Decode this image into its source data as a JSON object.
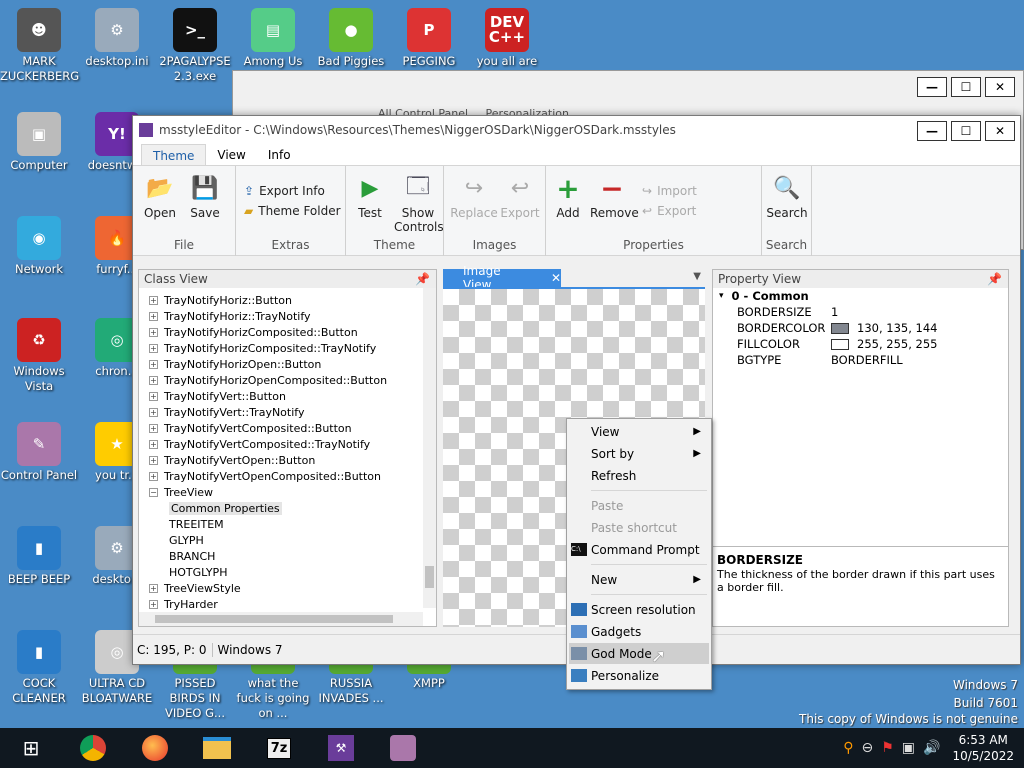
{
  "desktop": {
    "icons": [
      {
        "label": "MARK ZUCKERBERG",
        "glyph": "☻",
        "color": "#555"
      },
      {
        "label": "desktop.ini",
        "glyph": "⚙",
        "color": "#9ab"
      },
      {
        "label": "2PAGALYPSE 2.3.exe",
        "glyph": ">_",
        "color": "#111"
      },
      {
        "label": "Among Us",
        "glyph": "▤",
        "color": "#5c8"
      },
      {
        "label": "Bad Piggies",
        "glyph": "●",
        "color": "#6b3"
      },
      {
        "label": "PEGGING",
        "glyph": "P",
        "color": "#d33"
      },
      {
        "label": "you all are",
        "glyph": "DEV C++",
        "color": "#c22"
      },
      {
        "label": "Computer",
        "glyph": "▣",
        "color": "#bbb"
      },
      {
        "label": "doesntw...",
        "glyph": "Y!",
        "color": "#6b2da8"
      },
      {
        "label": "Network",
        "glyph": "◉",
        "color": "#3ad"
      },
      {
        "label": "furryf...",
        "glyph": "🔥",
        "color": "#e63"
      },
      {
        "label": "Windows Vista",
        "glyph": "♻",
        "color": "#c22"
      },
      {
        "label": "chron...",
        "glyph": "◎",
        "color": "#2a7"
      },
      {
        "label": "Control Panel",
        "glyph": "✎",
        "color": "#a7a"
      },
      {
        "label": "you tr...",
        "glyph": "★",
        "color": "#fc0"
      },
      {
        "label": "BEEP BEEP",
        "glyph": "▮",
        "color": "#2a7cc8"
      },
      {
        "label": "deskto...",
        "glyph": "⚙",
        "color": "#9ab"
      },
      {
        "label": "COCK CLEANER",
        "glyph": "▮",
        "color": "#2a7cc8"
      },
      {
        "label": "ULTRA CD BLOATWARE",
        "glyph": "◎",
        "color": "#ccc"
      },
      {
        "label": "PISSED BIRDS IN VIDEO G...",
        "glyph": "▲",
        "color": "#5a3"
      },
      {
        "label": "what the fuck is going on ...",
        "glyph": "▲",
        "color": "#5a3"
      },
      {
        "label": "RUSSIA INVADES ...",
        "glyph": "▲",
        "color": "#5a3"
      },
      {
        "label": "XMPP",
        "glyph": "▲",
        "color": "#5a3"
      }
    ],
    "watermark": {
      "line1": "Windows 7",
      "line2": "Build 7601",
      "line3": "This copy of Windows is not genuine"
    }
  },
  "back_window": {
    "partial_text": "All Control Panel ... Personalization"
  },
  "window": {
    "title": "msstyleEditor - C:\\Windows\\Resources\\Themes\\NiggerOSDark\\NiggerOSDark.msstyles",
    "controls": {
      "minimize": "—",
      "maximize": "☐",
      "close": "✕"
    },
    "tabs": [
      "Theme",
      "View",
      "Info"
    ],
    "ribbon": {
      "groups": {
        "file": "File",
        "extras": "Extras",
        "theme": "Theme",
        "images": "Images",
        "properties": "Properties",
        "search": "Search"
      },
      "open": "Open",
      "save": "Save",
      "export_info": "Export Info",
      "theme_folder": "Theme Folder",
      "test": "Test",
      "show_controls": "Show Controls",
      "replace": "Replace",
      "export": "Export",
      "add": "Add",
      "remove": "Remove",
      "import_small": "Import",
      "export_small": "Export",
      "search": "Search"
    },
    "class_view": {
      "header": "Class View",
      "items": [
        {
          "label": "TrayNotifyHoriz::Button",
          "exp": "+"
        },
        {
          "label": "TrayNotifyHoriz::TrayNotify",
          "exp": "+"
        },
        {
          "label": "TrayNotifyHorizComposited::Button",
          "exp": "+"
        },
        {
          "label": "TrayNotifyHorizComposited::TrayNotify",
          "exp": "+"
        },
        {
          "label": "TrayNotifyHorizOpen::Button",
          "exp": "+"
        },
        {
          "label": "TrayNotifyHorizOpenComposited::Button",
          "exp": "+"
        },
        {
          "label": "TrayNotifyVert::Button",
          "exp": "+"
        },
        {
          "label": "TrayNotifyVert::TrayNotify",
          "exp": "+"
        },
        {
          "label": "TrayNotifyVertComposited::Button",
          "exp": "+"
        },
        {
          "label": "TrayNotifyVertComposited::TrayNotify",
          "exp": "+"
        },
        {
          "label": "TrayNotifyVertOpen::Button",
          "exp": "+"
        },
        {
          "label": "TrayNotifyVertOpenComposited::Button",
          "exp": "+"
        },
        {
          "label": "TreeView",
          "exp": "−"
        },
        {
          "label": "Common Properties",
          "exp": "",
          "child": true,
          "selected": true
        },
        {
          "label": "TREEITEM",
          "exp": "",
          "child": true
        },
        {
          "label": "GLYPH",
          "exp": "",
          "child": true
        },
        {
          "label": "BRANCH",
          "exp": "",
          "child": true
        },
        {
          "label": "HOTGLYPH",
          "exp": "",
          "child": true
        },
        {
          "label": "TreeViewStyle",
          "exp": "+"
        },
        {
          "label": "TryHarder",
          "exp": "+"
        }
      ]
    },
    "image_view": {
      "tab": "Image View"
    },
    "property_view": {
      "header": "Property View",
      "group": "0 - Common",
      "rows": [
        {
          "name": "BORDERSIZE",
          "value": "1",
          "swatch": ""
        },
        {
          "name": "BORDERCOLOR",
          "value": "130, 135, 144",
          "swatch": "#828790"
        },
        {
          "name": "FILLCOLOR",
          "value": "255, 255, 255",
          "swatch": "#ffffff"
        },
        {
          "name": "BGTYPE",
          "value": "BORDERFILL",
          "swatch": ""
        }
      ],
      "desc_title": "BORDERSIZE",
      "desc_text": "The thickness of the border drawn if this part uses a border fill."
    },
    "status": {
      "counts": "C: 195, P: 0",
      "os": "Windows 7"
    }
  },
  "context_menu": {
    "view": "View",
    "sort_by": "Sort by",
    "refresh": "Refresh",
    "paste": "Paste",
    "paste_shortcut": "Paste shortcut",
    "command_prompt": "Command Prompt",
    "new": "New",
    "screen_resolution": "Screen resolution",
    "gadgets": "Gadgets",
    "god_mode": "God Mode",
    "personalize": "Personalize"
  },
  "taskbar": {
    "time": "6:53 AM",
    "date": "10/5/2022"
  }
}
